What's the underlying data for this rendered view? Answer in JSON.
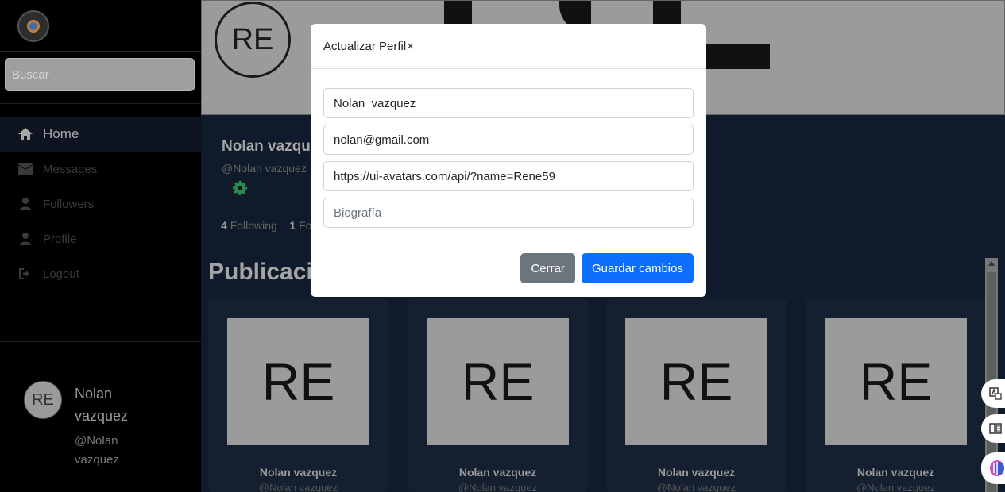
{
  "sidebar": {
    "search_placeholder": "Buscar",
    "nav": [
      {
        "label": "Home",
        "icon": "home-icon",
        "active": true
      },
      {
        "label": "Messages",
        "icon": "envelope-icon"
      },
      {
        "label": "Followers",
        "icon": "user-icon"
      },
      {
        "label": "Profile",
        "icon": "user-icon"
      },
      {
        "label": "Logout",
        "icon": "logout-icon"
      }
    ],
    "user": {
      "avatar_initials": "RE",
      "name": "Nolan vazquez",
      "handle": "@Nolan vazquez"
    }
  },
  "profile": {
    "avatar_initials": "RE",
    "name": "Nolan vazquez",
    "handle": "@Nolan vazquez",
    "following_count": "4",
    "following_label": "Following",
    "followers_count": "1",
    "followers_label": "Fo"
  },
  "publications": {
    "title": "Publicaciones",
    "cards": [
      {
        "initials": "RE",
        "name": "Nolan vazquez",
        "handle": "@Nolan vazquez"
      },
      {
        "initials": "RE",
        "name": "Nolan vazquez",
        "handle": "@Nolan vazquez"
      },
      {
        "initials": "RE",
        "name": "Nolan vazquez",
        "handle": "@Nolan vazquez"
      },
      {
        "initials": "RE",
        "name": "Nolan vazquez",
        "handle": "@Nolan vazquez"
      }
    ]
  },
  "modal": {
    "title": "Actualizar Perfil",
    "close_symbol": "×",
    "fields": {
      "name_value": "Nolan  vazquez",
      "email_value": "nolan@gmail.com",
      "avatar_url_value": "https://ui-avatars.com/api/?name=Rene59",
      "bio_placeholder": "Biografía"
    },
    "cancel_label": "Cerrar",
    "save_label": "Guardar cambios"
  },
  "colors": {
    "primary": "#0d6efd",
    "secondary": "#6c757d",
    "sidebar_bg": "#000000",
    "main_bg": "#0f1a2a"
  }
}
